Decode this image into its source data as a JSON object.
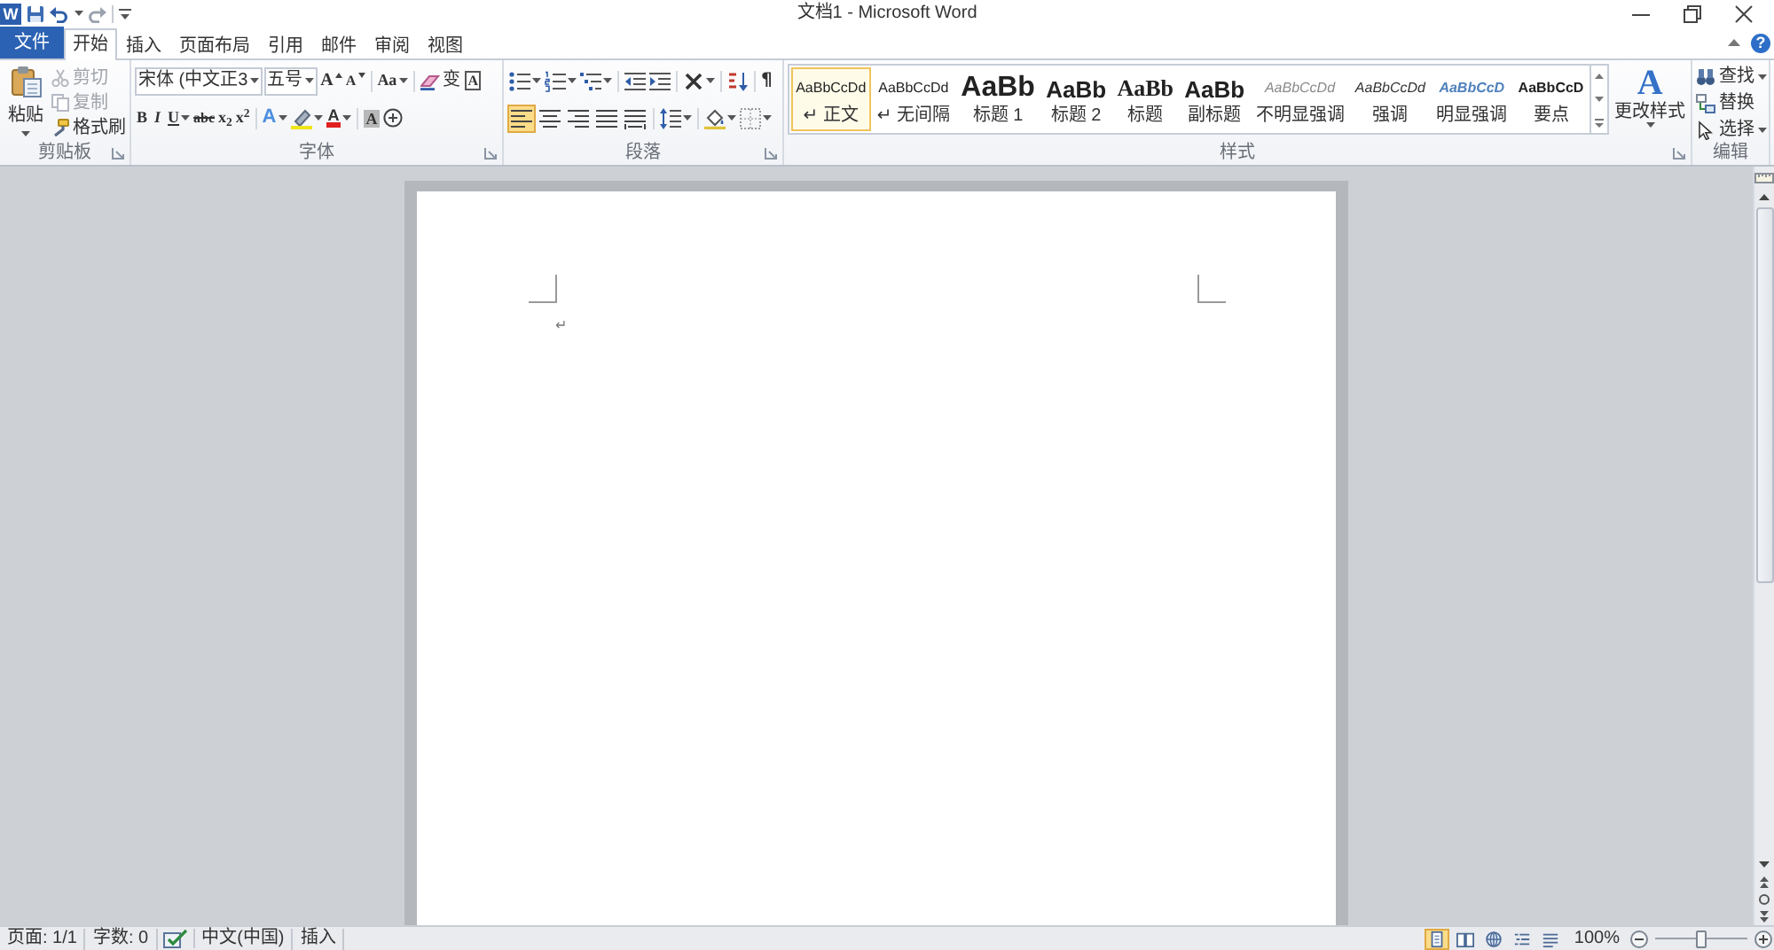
{
  "app": {
    "logo_letter": "W"
  },
  "window": {
    "title": "文档1 - Microsoft Word"
  },
  "tabs": [
    {
      "label": "文件",
      "kind": "file",
      "selected": false
    },
    {
      "label": "开始",
      "kind": "tab",
      "selected": true
    },
    {
      "label": "插入",
      "kind": "tab",
      "selected": false
    },
    {
      "label": "页面布局",
      "kind": "tab",
      "selected": false
    },
    {
      "label": "引用",
      "kind": "tab",
      "selected": false
    },
    {
      "label": "邮件",
      "kind": "tab",
      "selected": false
    },
    {
      "label": "审阅",
      "kind": "tab",
      "selected": false
    },
    {
      "label": "视图",
      "kind": "tab",
      "selected": false
    }
  ],
  "help": {
    "text": "?"
  },
  "ribbon": {
    "clipboard": {
      "label": "剪贴板",
      "launcher": true,
      "paste": "粘贴",
      "items": [
        {
          "kind": "cut",
          "label": "剪切",
          "disabled": true
        },
        {
          "kind": "copy",
          "label": "复制",
          "disabled": true
        },
        {
          "kind": "painter",
          "label": "格式刷",
          "disabled": false
        }
      ]
    },
    "font": {
      "label": "字体",
      "launcher": true,
      "font_name": "宋体 (中文正3",
      "font_size": "五号",
      "row1": [
        {
          "kind": "grow",
          "text": "A",
          "dropdown": false
        },
        {
          "kind": "shrink",
          "text": "A",
          "dropdown": false
        },
        {
          "kind": "case",
          "text": "Aa",
          "dropdown": true
        },
        {
          "kind": "clear",
          "dropdown": false
        },
        {
          "kind": "phonetic",
          "text": "变",
          "dropdown": false
        },
        {
          "kind": "border",
          "text": "A",
          "dropdown": false
        }
      ],
      "row2": [
        {
          "kind": "bold",
          "text": "B",
          "dropdown": false
        },
        {
          "kind": "italic",
          "text": "I",
          "dropdown": false
        },
        {
          "kind": "underline",
          "text": "U",
          "dropdown": true
        },
        {
          "kind": "strike",
          "text": "abc",
          "dropdown": false
        },
        {
          "kind": "subscript",
          "text": "x$_{2}$",
          "dropdown": false
        },
        {
          "kind": "superscript",
          "text": "x$^{2}$",
          "dropdown": false
        },
        {
          "kind": "effects",
          "text": "A",
          "dropdown": true
        },
        {
          "kind": "highlight",
          "dropdown": true
        },
        {
          "kind": "color",
          "text": "A",
          "dropdown": true
        },
        {
          "kind": "shading",
          "text": "A",
          "dropdown": false
        },
        {
          "kind": "enclose",
          "dropdown": false
        }
      ]
    },
    "paragraph": {
      "label": "段落",
      "launcher": true,
      "row1": [
        {
          "kind": "bullets",
          "dropdown": true
        },
        {
          "kind": "numbering",
          "dropdown": true
        },
        {
          "kind": "multilevel",
          "dropdown": true
        },
        {
          "kind": "outdent",
          "dropdown": false
        },
        {
          "kind": "indent",
          "dropdown": false
        },
        {
          "kind": "asian_layout",
          "dropdown": true
        },
        {
          "kind": "sort",
          "dropdown": false
        },
        {
          "kind": "marks",
          "text": "¶",
          "dropdown": false
        }
      ],
      "alignments": [
        {
          "kind": "left",
          "selected": true
        },
        {
          "kind": "center",
          "selected": false
        },
        {
          "kind": "right",
          "selected": false
        },
        {
          "kind": "justify",
          "selected": false
        },
        {
          "kind": "distributed",
          "selected": false
        }
      ],
      "row2": [
        {
          "kind": "line_spacing",
          "dropdown": true
        },
        {
          "kind": "shading",
          "dropdown": true
        },
        {
          "kind": "borders",
          "dropdown": true
        }
      ]
    },
    "styles": {
      "label": "样式",
      "launcher": true,
      "gallery": [
        {
          "kind": "normal",
          "preview": "AaBbCcDd",
          "label": "↵ 正文",
          "selected": true
        },
        {
          "kind": "no_spacing",
          "preview": "AaBbCcDd",
          "label": "↵ 无间隔",
          "selected": false
        },
        {
          "kind": "heading1",
          "preview": "AaBb",
          "label": "标题 1",
          "selected": false
        },
        {
          "kind": "heading2",
          "preview": "AaBb",
          "label": "标题 2",
          "selected": false
        },
        {
          "kind": "title",
          "preview": "AaBb",
          "label": "标题",
          "selected": false
        },
        {
          "kind": "subtitle",
          "preview": "AaBb",
          "label": "副标题",
          "selected": false
        },
        {
          "kind": "subtle_emphasis",
          "preview": "AaBbCcDd",
          "label": "不明显强调",
          "selected": false
        },
        {
          "kind": "emphasis",
          "preview": "AaBbCcDd",
          "label": "强调",
          "selected": false
        },
        {
          "kind": "intense_emphasis",
          "preview": "AaBbCcD",
          "label": "明显强调",
          "selected": false
        },
        {
          "kind": "strong",
          "preview": "AaBbCcD",
          "label": "要点",
          "selected": false
        }
      ],
      "change_styles": {
        "glyph": "A",
        "label": "更改样式"
      }
    },
    "editing": {
      "label": "编辑",
      "launcher": false,
      "items": [
        {
          "kind": "find",
          "label": "查找",
          "dropdown": true
        },
        {
          "kind": "replace",
          "label": "替换",
          "dropdown": false
        },
        {
          "kind": "select",
          "label": "选择",
          "dropdown": true
        }
      ]
    }
  },
  "document": {
    "paragraph_mark": "↵"
  },
  "status_bar": {
    "page": "页面: 1/1",
    "words": "字数: 0",
    "language": "中文(中国)",
    "mode": "插入",
    "views": [
      {
        "kind": "print_layout",
        "selected": true
      },
      {
        "kind": "reading",
        "selected": false
      },
      {
        "kind": "web",
        "selected": false
      },
      {
        "kind": "outline",
        "selected": false
      },
      {
        "kind": "draft",
        "selected": false
      }
    ],
    "zoom": {
      "reading": "100%",
      "level": 0.5
    }
  }
}
